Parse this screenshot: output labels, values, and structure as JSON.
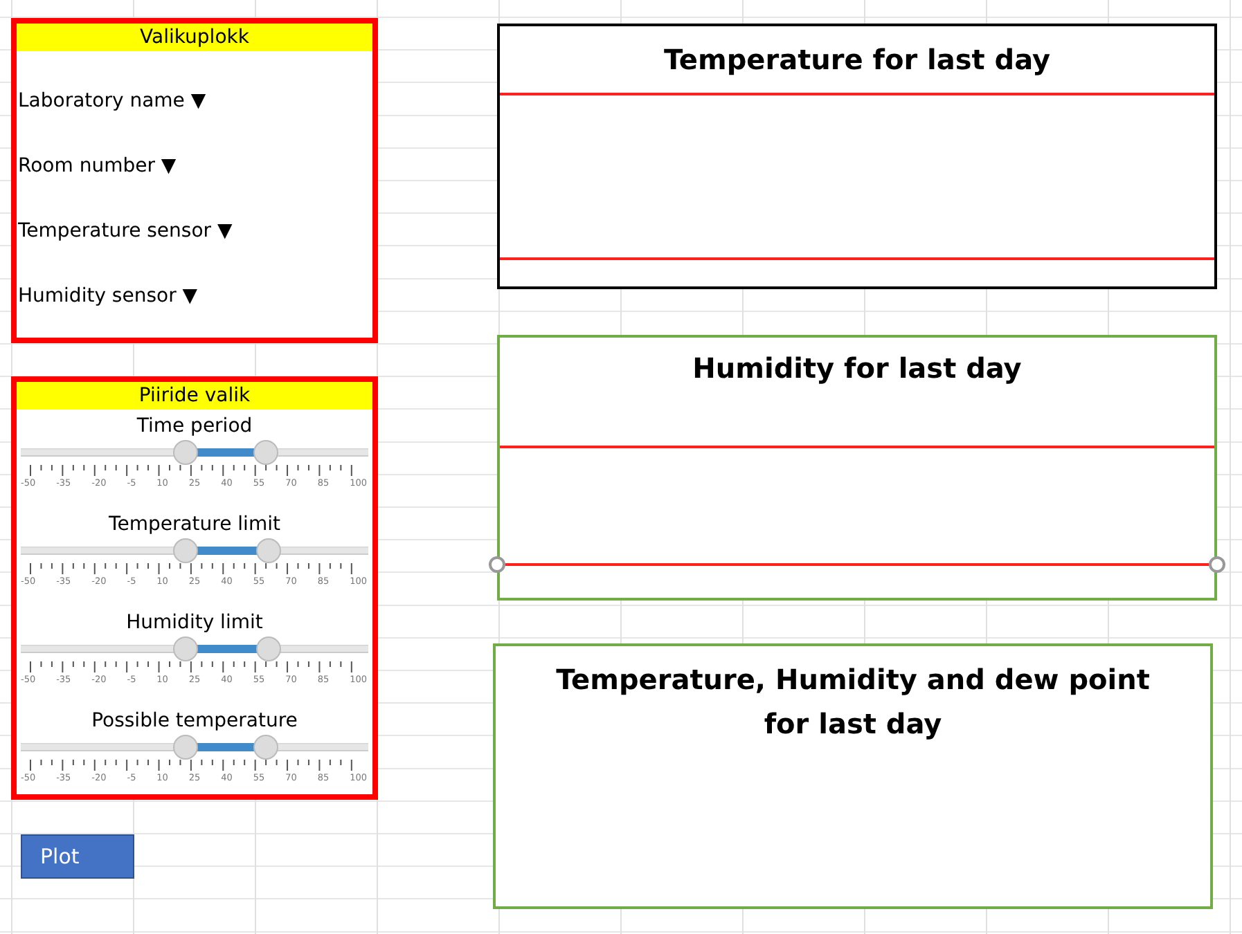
{
  "selection_panel": {
    "title": "Valikuplokk",
    "dropdowns": [
      {
        "label": "Laboratory name",
        "arrow": "▼"
      },
      {
        "label": "Room number",
        "arrow": "▼"
      },
      {
        "label": "Temperature sensor",
        "arrow": "▼"
      },
      {
        "label": "Humidity sensor",
        "arrow": "▼"
      }
    ]
  },
  "limits_panel": {
    "title": "Piiride valik",
    "sliders": [
      {
        "label": "Time period",
        "thumbs": [
          {
            "level": 0.47
          },
          {
            "level": 0.72
          }
        ],
        "ticks": [
          "-50",
          "-35",
          "-20",
          "-5",
          "10",
          "25",
          "40",
          "55",
          "70",
          "85",
          "100"
        ]
      },
      {
        "label": "Temperature limit",
        "thumbs": [
          {
            "level": 0.47
          },
          {
            "level": 0.73
          }
        ],
        "ticks": [
          "-50",
          "-35",
          "-20",
          "-5",
          "10",
          "25",
          "40",
          "55",
          "70",
          "85",
          "100"
        ]
      },
      {
        "label": "Humidity limit",
        "thumbs": [
          {
            "level": 0.47
          },
          {
            "level": 0.73
          }
        ],
        "ticks": [
          "-50",
          "-35",
          "-20",
          "-5",
          "10",
          "25",
          "40",
          "55",
          "70",
          "85",
          "100"
        ]
      },
      {
        "label": "Possible temperature",
        "thumbs": [
          {
            "level": 0.47
          },
          {
            "level": 0.72
          }
        ],
        "ticks": [
          "-50",
          "-35",
          "-20",
          "-5",
          "10",
          "25",
          "40",
          "55",
          "70",
          "85",
          "100"
        ]
      }
    ]
  },
  "plot_button": "Plot",
  "charts": [
    {
      "title": "Temperature for last day",
      "color": "#000000",
      "lines": [
        {
          "selected": false
        },
        {
          "selected": false
        }
      ]
    },
    {
      "title": "Humidity for last day",
      "color": "#70ad47",
      "lines": [
        {
          "selected": false
        },
        {
          "selected": true
        }
      ]
    },
    {
      "title": "Temperature, Humidity and dew point for last day",
      "color": "#70ad47"
    }
  ]
}
